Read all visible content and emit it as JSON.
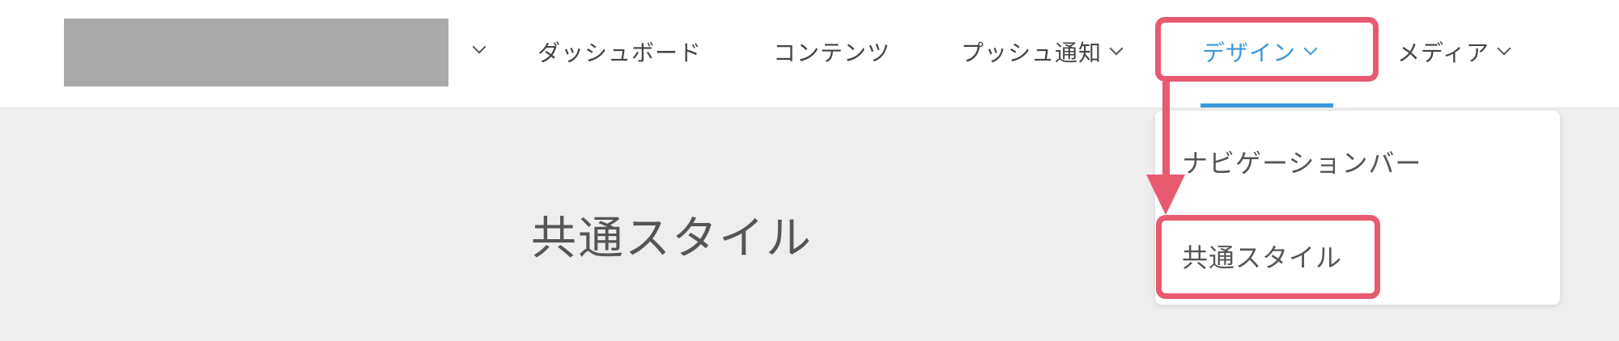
{
  "header": {
    "logo_chevron_icon": "chevron-down-icon",
    "nav": {
      "dashboard": "ダッシュボード",
      "contents": "コンテンツ",
      "push": "プッシュ通知",
      "design": "デザイン",
      "media": "メディア"
    },
    "active_color": "#3a9ad9"
  },
  "dropdown": {
    "items": [
      "ナビゲーションバー",
      "共通スタイル"
    ]
  },
  "main": {
    "page_title": "共通スタイル",
    "background": "#eeeeee"
  },
  "annotation": {
    "highlight_color": "#e85a70"
  }
}
